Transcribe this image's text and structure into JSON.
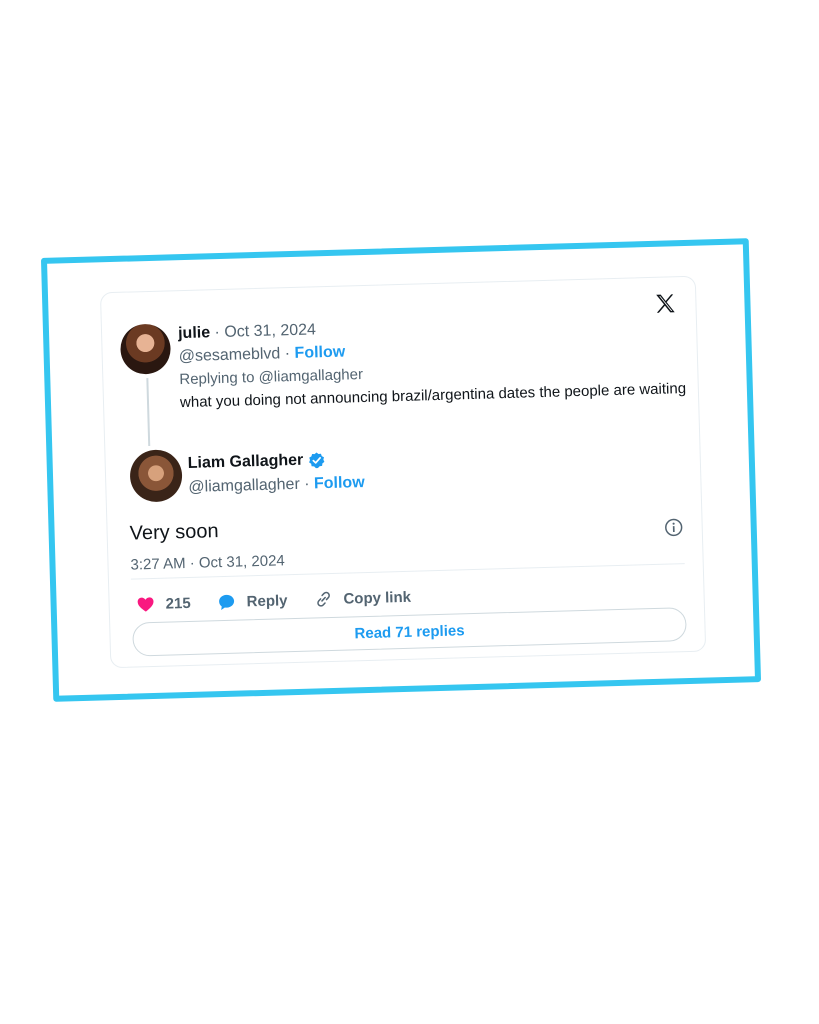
{
  "colors": {
    "frame_border": "#35c6f0",
    "accent": "#1d9bf0",
    "like": "#f91880",
    "text_primary": "#0f1419",
    "text_secondary": "#536471"
  },
  "card": {
    "logo_icon": "x-logo-icon",
    "quoted_tweet": {
      "author_name": "julie",
      "date": "· Oct 31, 2024",
      "handle": "@sesameblvd ·",
      "follow_label": "Follow",
      "replying_to": "Replying to @liamgallagher",
      "text": "what you doing not announcing brazil/argentina dates the people are waiting"
    },
    "main_tweet": {
      "author_name": "Liam Gallagher",
      "verified_icon": "verified-badge-icon",
      "handle": "@liamgallagher ·",
      "follow_label": "Follow",
      "text": "Very soon",
      "timestamp": "3:27 AM · Oct 31, 2024",
      "info_icon": "info-icon"
    },
    "actions": {
      "like_count": "215",
      "reply_label": "Reply",
      "copy_link_label": "Copy link"
    },
    "read_replies_label": "Read 71 replies"
  }
}
